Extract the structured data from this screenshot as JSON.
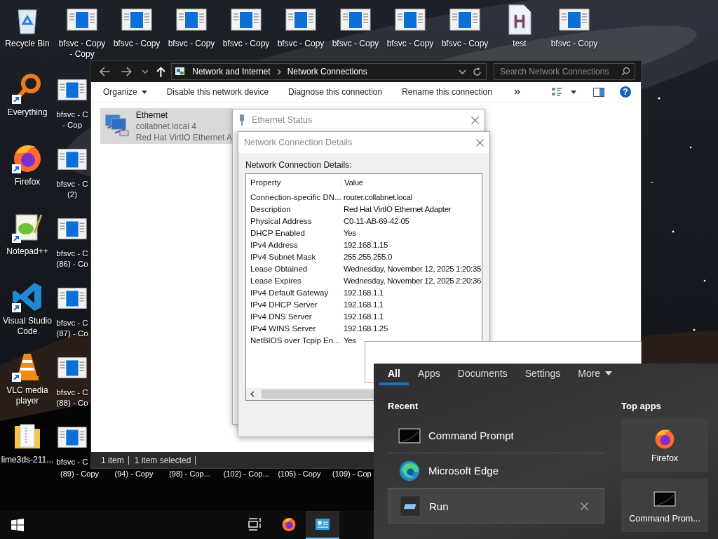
{
  "desktop": {
    "top_row": [
      {
        "kind": "recycle-bin",
        "shortcut": false,
        "lines": [
          "Recycle Bin"
        ]
      },
      {
        "kind": "window-file",
        "shortcut": false,
        "lines": [
          "bfsvc - Copy",
          "- Copy"
        ]
      },
      {
        "kind": "window-file",
        "shortcut": false,
        "lines": [
          "bfsvc - Copy"
        ]
      },
      {
        "kind": "window-file",
        "shortcut": false,
        "lines": [
          "bfsvc - Copy"
        ]
      },
      {
        "kind": "window-file",
        "shortcut": false,
        "lines": [
          "bfsvc - Copy"
        ]
      },
      {
        "kind": "window-file",
        "shortcut": false,
        "lines": [
          "bfsvc - Copy"
        ]
      },
      {
        "kind": "window-file",
        "shortcut": false,
        "lines": [
          "bfsvc - Copy"
        ]
      },
      {
        "kind": "window-file",
        "shortcut": false,
        "lines": [
          "bfsvc - Copy"
        ]
      },
      {
        "kind": "window-file",
        "shortcut": false,
        "lines": [
          "bfsvc - Copy"
        ]
      },
      {
        "kind": "letter-file",
        "badge": "H",
        "shortcut": false,
        "lines": [
          "test"
        ]
      },
      {
        "kind": "window-file",
        "shortcut": false,
        "lines": [
          "bfsvc - Copy"
        ]
      }
    ],
    "left_column": [
      {
        "kind": "everything",
        "shortcut": true,
        "lines": [
          "Everything"
        ]
      },
      {
        "kind": "firefox",
        "shortcut": true,
        "lines": [
          "Firefox"
        ]
      },
      {
        "kind": "notepad",
        "shortcut": true,
        "lines": [
          "Notepad++"
        ]
      },
      {
        "kind": "vscode",
        "shortcut": true,
        "lines": [
          "Visual Studio",
          "Code"
        ]
      },
      {
        "kind": "vlc",
        "shortcut": true,
        "lines": [
          "VLC media",
          "player"
        ]
      },
      {
        "kind": "archive",
        "shortcut": false,
        "lines": [
          "lime3ds-211..."
        ]
      }
    ],
    "second_column": [
      {
        "lines": [
          "bfsvc - C",
          "- Cop"
        ]
      },
      {
        "lines": [
          "bfsvc - C",
          "(2)"
        ]
      },
      {
        "lines": [
          "bfsvc - C",
          "(86) - Co"
        ]
      },
      {
        "lines": [
          "bfsvc - C",
          "(87) - Co"
        ]
      },
      {
        "lines": [
          "bfsvc - C",
          "(88) - Co"
        ]
      },
      {
        "lines": [
          "bfsvc - C"
        ]
      }
    ],
    "bottom_labels": [
      "(89) - Copy",
      "(94) - Copy",
      "(98) - Cop...",
      "(102) - Cop...",
      "(105) - Copy",
      "(109) - Cop"
    ]
  },
  "explorer": {
    "breadcrumb": [
      "Network and Internet",
      "Network Connections"
    ],
    "search": {
      "placeholder": "Search Network Connections"
    },
    "commands": [
      {
        "label": "Organize",
        "menu": true
      },
      {
        "label": "Disable this network device",
        "menu": false
      },
      {
        "label": "Diagnose this connection",
        "menu": false
      },
      {
        "label": "Rename this connection",
        "menu": false
      }
    ],
    "help": "?",
    "items": [
      {
        "name": "Ethernet",
        "lines": [
          "collabnet.local 4",
          "Red Hat VirtIO Ethernet A"
        ],
        "selected": true
      }
    ],
    "status_bar": [
      "1 item",
      "1 item selected"
    ]
  },
  "status_dialog": {
    "title": "Ethernet Status"
  },
  "details_dialog": {
    "title": "Network Connection Details",
    "caption": "Network Connection Details:",
    "columns": [
      "Property",
      "Value"
    ],
    "rows": [
      {
        "property": "Connection-specific DN...",
        "value": "router.collabnet.local"
      },
      {
        "property": "Description",
        "value": "Red Hat VirtIO Ethernet Adapter"
      },
      {
        "property": "Physical Address",
        "value": "C0-11-AB-69-42-05"
      },
      {
        "property": "DHCP Enabled",
        "value": "Yes"
      },
      {
        "property": "IPv4 Address",
        "value": "192.168.1.15"
      },
      {
        "property": "IPv4 Subnet Mask",
        "value": "255.255.255.0"
      },
      {
        "property": "Lease Obtained",
        "value": "Wednesday, November 12, 2025 1:20:35"
      },
      {
        "property": "Lease Expires",
        "value": "Wednesday, November 12, 2025 2:20:36"
      },
      {
        "property": "IPv4 Default Gateway",
        "value": "192.168.1.1"
      },
      {
        "property": "IPv4 DHCP Server",
        "value": "192.168.1.1"
      },
      {
        "property": "IPv4 DNS Server",
        "value": "192.168.1.1"
      },
      {
        "property": "IPv4 WINS Server",
        "value": "192.168.1.25"
      },
      {
        "property": "NetBIOS over Tcpip En...",
        "value": "Yes"
      }
    ]
  },
  "search_panel": {
    "tabs": [
      {
        "label": "All",
        "selected": true,
        "menu": false
      },
      {
        "label": "Apps",
        "selected": false,
        "menu": false
      },
      {
        "label": "Documents",
        "selected": false,
        "menu": false
      },
      {
        "label": "Settings",
        "selected": false,
        "menu": false
      },
      {
        "label": "More",
        "selected": false,
        "menu": true
      }
    ],
    "recent_title": "Recent",
    "recent": [
      {
        "label": "Command Prompt",
        "kind": "console",
        "selected": false
      },
      {
        "label": "Microsoft Edge",
        "kind": "edge",
        "selected": false
      },
      {
        "label": "Run",
        "kind": "run",
        "selected": true
      }
    ],
    "top_apps_title": "Top apps",
    "top_apps": [
      {
        "label": "Firefox",
        "kind": "firefox"
      },
      {
        "label": "Command Prom...",
        "kind": "console"
      }
    ]
  },
  "taskbar": {
    "apps": [
      {
        "kind": "task-view",
        "running": false
      },
      {
        "kind": "firefox",
        "running": false
      },
      {
        "kind": "network-app",
        "running": true
      }
    ]
  }
}
